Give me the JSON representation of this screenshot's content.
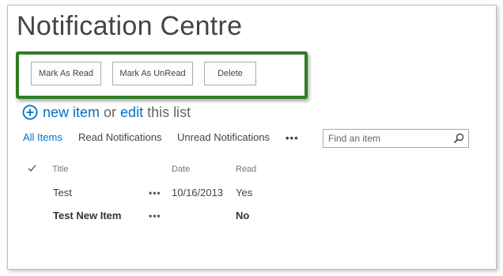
{
  "page": {
    "title": "Notification Centre"
  },
  "toolbar": {
    "mark_read_label": "Mark As Read",
    "mark_unread_label": "Mark As UnRead",
    "delete_label": "Delete"
  },
  "new_item": {
    "new_item_label": "new item",
    "or_label": "or",
    "edit_label": "edit",
    "this_list_label": "this list"
  },
  "views": {
    "items": [
      "All Items",
      "Read Notifications",
      "Unread Notifications"
    ],
    "active": "All Items",
    "more_label": "•••"
  },
  "search": {
    "placeholder": "Find an item"
  },
  "table": {
    "columns": [
      "Title",
      "Date",
      "Read"
    ],
    "rows": [
      {
        "title": "Test",
        "menu": "•••",
        "date": "10/16/2013",
        "read": "Yes"
      },
      {
        "title": "Test New Item",
        "menu": "•••",
        "date": "",
        "read": "No"
      }
    ]
  },
  "colors": {
    "accent": "#0072c6",
    "highlight_border": "#2f7d22",
    "text": "#444444"
  },
  "icons": {
    "add": "plus-circle-icon",
    "search": "search-icon",
    "select_all": "checkmark-icon"
  }
}
